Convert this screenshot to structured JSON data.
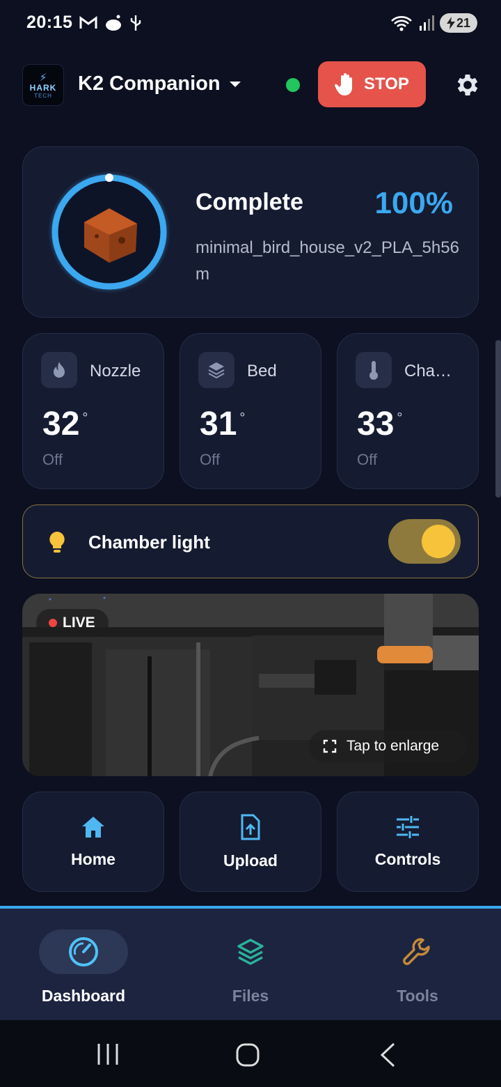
{
  "status_bar": {
    "time": "20:15",
    "battery": "21"
  },
  "app_bar": {
    "logo": {
      "line1": "Hark",
      "line2": "HARK",
      "line3": "TECH"
    },
    "title": "K2 Companion",
    "connection": "connected",
    "stop_label": "STOP"
  },
  "print": {
    "status": "Complete",
    "percent": "100%",
    "progress": 1.0,
    "filename": "minimal_bird_house_v2_PLA_5h56m"
  },
  "temps": [
    {
      "label": "Nozzle",
      "value": "32",
      "unit": "°",
      "state": "Off",
      "icon": "flame-icon"
    },
    {
      "label": "Bed",
      "value": "31",
      "unit": "°",
      "state": "Off",
      "icon": "layers-icon"
    },
    {
      "label": "Cha…",
      "value": "33",
      "unit": "°",
      "state": "Off",
      "icon": "thermometer-icon"
    }
  ],
  "chamber_light": {
    "label": "Chamber light",
    "on": true
  },
  "camera": {
    "live_label": "LIVE",
    "enlarge_label": "Tap to enlarge"
  },
  "actions": [
    {
      "label": "Home",
      "icon": "home-icon"
    },
    {
      "label": "Upload",
      "icon": "upload-file-icon"
    },
    {
      "label": "Controls",
      "icon": "sliders-icon"
    }
  ],
  "bottom_nav": [
    {
      "label": "Dashboard",
      "icon": "gauge-icon",
      "active": true
    },
    {
      "label": "Files",
      "icon": "layers-icon",
      "active": false
    },
    {
      "label": "Tools",
      "icon": "wrench-icon",
      "active": false
    }
  ],
  "colors": {
    "accent": "#3ba8f0",
    "stop": "#e5534b",
    "online": "#22c55e",
    "light": "#f6c33b"
  }
}
